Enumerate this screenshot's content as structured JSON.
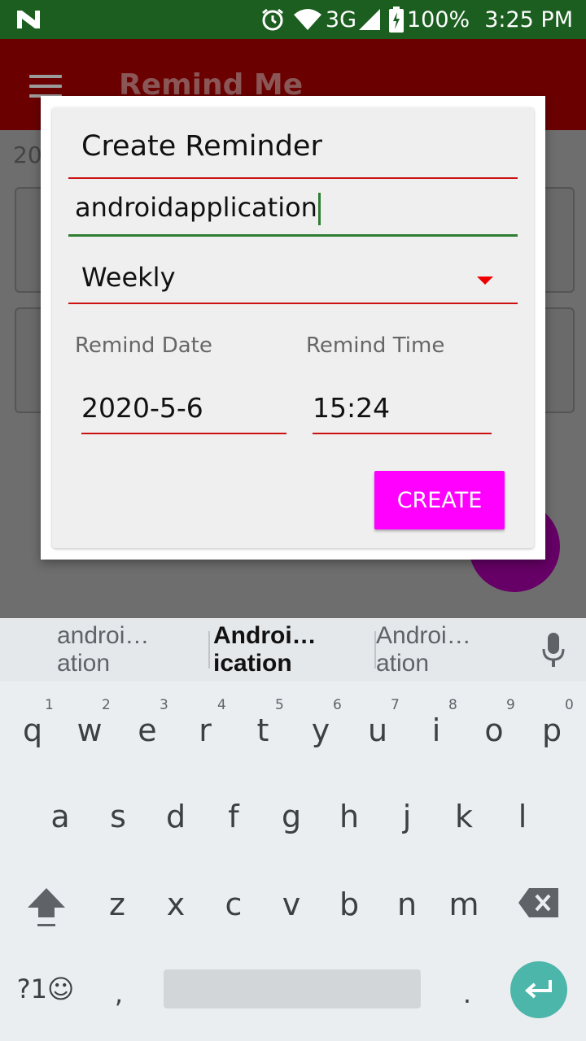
{
  "status_bar": {
    "network": "3G",
    "battery": "100%",
    "time": "3:25 PM"
  },
  "app_bar": {
    "title": "Remind Me"
  },
  "background": {
    "header_text": "20"
  },
  "dialog": {
    "title_value": "Create Reminder",
    "text_value": "androidapplication",
    "repeat_value": "Weekly",
    "remind_date_label": "Remind Date",
    "remind_time_label": "Remind Time",
    "date_value": "2020-5-6",
    "time_value": "15:24",
    "create_label": "CREATE"
  },
  "keyboard": {
    "suggestions": [
      "androi…ation",
      "Androi…ication",
      "Androi…ation"
    ],
    "row1": [
      "q",
      "w",
      "e",
      "r",
      "t",
      "y",
      "u",
      "i",
      "o",
      "p"
    ],
    "row1_nums": [
      "1",
      "2",
      "3",
      "4",
      "5",
      "6",
      "7",
      "8",
      "9",
      "0"
    ],
    "row2": [
      "a",
      "s",
      "d",
      "f",
      "g",
      "h",
      "j",
      "k",
      "l"
    ],
    "row3": [
      "z",
      "x",
      "c",
      "v",
      "b",
      "n",
      "m"
    ],
    "symbols_label": "?1☺",
    "comma": ",",
    "period": "."
  },
  "colors": {
    "status_bar": "#1b5e20",
    "app_bar": "#6b0000",
    "accent_red": "#cc1111",
    "focus_green": "#2e7d32",
    "create_button": "#ff00ff",
    "fab": "#660066",
    "enter_key": "#4cb6aa"
  },
  "icons": {
    "status": [
      "n-notification-icon",
      "alarm-icon",
      "wifi-icon",
      "signal-icon",
      "battery-charging-icon"
    ],
    "menu": "menu-icon",
    "spinner": "dropdown-arrow-icon",
    "keyboard": [
      "mic-icon",
      "shift-icon",
      "backspace-icon",
      "enter-icon"
    ]
  }
}
